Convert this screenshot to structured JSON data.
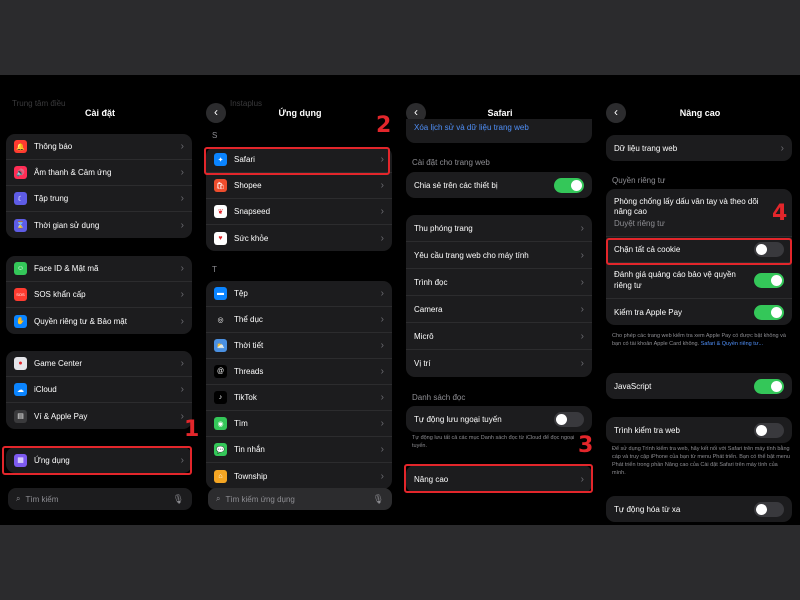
{
  "panel1": {
    "faded_top": "Trung tâm điều",
    "title": "Cài đặt",
    "group1": [
      {
        "label": "Thông báo",
        "color": "#ff3b30",
        "icon": "bell-icon",
        "glyph": "🔔"
      },
      {
        "label": "Âm thanh & Cảm ứng",
        "color": "#ff2d55",
        "icon": "speaker-icon",
        "glyph": "🔊"
      },
      {
        "label": "Tập trung",
        "color": "#5e5ce6",
        "icon": "moon-icon",
        "glyph": "☾"
      },
      {
        "label": "Thời gian sử dụng",
        "color": "#5e5ce6",
        "icon": "hourglass-icon",
        "glyph": "⌛"
      }
    ],
    "group2": [
      {
        "label": "Face ID & Mật mã",
        "color": "#34c759",
        "icon": "faceid-icon",
        "glyph": "☺"
      },
      {
        "label": "SOS khẩn cấp",
        "color": "#ff3b30",
        "icon": "sos-icon",
        "glyph": "SOS"
      },
      {
        "label": "Quyền riêng tư & Bảo mật",
        "color": "#0a84ff",
        "icon": "hand-icon",
        "glyph": "✋"
      }
    ],
    "group3": [
      {
        "label": "Game Center",
        "color": "#e5e5ea",
        "icon": "game-center-icon",
        "glyph": "●"
      },
      {
        "label": "iCloud",
        "color": "#0a84ff",
        "icon": "cloud-icon",
        "glyph": "☁"
      },
      {
        "label": "Ví & Apple Pay",
        "color": "#3a3a3c",
        "icon": "wallet-icon",
        "glyph": "▤"
      }
    ],
    "apps_row": {
      "label": "Ứng dụng",
      "color": "#7d5af0",
      "icon": "apps-grid-icon",
      "glyph": "▦"
    },
    "search_placeholder": "Tìm kiếm",
    "step": "1"
  },
  "panel2": {
    "faded_top": "Instaplus",
    "title": "Ứng dụng",
    "section_s": "S",
    "group_s": [
      {
        "label": "Safari",
        "color": "#0a84ff",
        "icon": "safari-icon",
        "glyph": "✦"
      },
      {
        "label": "Shopee",
        "color": "#ee4d2d",
        "icon": "shopee-icon",
        "glyph": "🛍"
      },
      {
        "label": "Snapseed",
        "color": "#ffffff",
        "icon": "snapseed-icon",
        "glyph": "❦"
      },
      {
        "label": "Sức khỏe",
        "color": "#ffffff",
        "icon": "health-icon",
        "glyph": "♥"
      }
    ],
    "section_t": "T",
    "group_t": [
      {
        "label": "Tệp",
        "color": "#0a84ff",
        "icon": "files-icon",
        "glyph": "▬"
      },
      {
        "label": "Thể dục",
        "color": "#1c1c1e",
        "icon": "fitness-icon",
        "glyph": "◎"
      },
      {
        "label": "Thời tiết",
        "color": "#4a90e2",
        "icon": "weather-icon",
        "glyph": "⛅"
      },
      {
        "label": "Threads",
        "color": "#000000",
        "icon": "threads-icon",
        "glyph": "@"
      },
      {
        "label": "TikTok",
        "color": "#000000",
        "icon": "tiktok-icon",
        "glyph": "♪"
      },
      {
        "label": "Tìm",
        "color": "#34c759",
        "icon": "find-my-icon",
        "glyph": "◉"
      },
      {
        "label": "Tin nhắn",
        "color": "#34c759",
        "icon": "messages-icon",
        "glyph": "💬"
      },
      {
        "label": "Township",
        "color": "#f5a623",
        "icon": "township-icon",
        "glyph": "⌂"
      }
    ],
    "search_placeholder": "Tìm kiếm ứng dụng",
    "step": "2"
  },
  "panel3": {
    "title": "Safari",
    "clear_history_link": "Xóa lịch sử và dữ liệu trang web",
    "section_web": "Cài đặt cho trang web",
    "share_devices": "Chia sẻ trên các thiết bị",
    "web_rows": [
      "Thu phóng trang",
      "Yêu cầu trang web cho máy tính",
      "Trình đọc",
      "Camera",
      "Micrô",
      "Vị trí"
    ],
    "section_reading": "Danh sách đọc",
    "auto_offline": "Tự động lưu ngoại tuyến",
    "reading_note": "Tự động lưu tất cả các mục Danh sách đọc từ iCloud để đọc ngoại tuyến.",
    "advanced": "Nâng cao",
    "step": "3"
  },
  "panel4": {
    "title": "Nâng cao",
    "website_data": "Dữ liệu trang web",
    "section_privacy": "Quyền riêng tư",
    "fingerprint": "Phòng chống lấy dấu vân tay và theo dõi nâng cao",
    "fingerprint_value": "Duyệt riêng tư",
    "block_cookies": "Chặn tất cả cookie",
    "privacy_ads": "Đánh giá quảng cáo bảo vệ quyền riêng tư",
    "check_apple_pay": "Kiểm tra Apple Pay",
    "apple_pay_note": "Cho phép các trang web kiểm tra xem Apple Pay có được bật không và bạn có tài khoản Apple Card không.",
    "apple_pay_link": "Safari & Quyền riêng tư...",
    "javascript": "JavaScript",
    "web_inspector": "Trình kiểm tra web",
    "inspector_note": "Để sử dụng Trình kiểm tra web, hãy kết nối với Safari trên máy tính bằng cáp và truy cập iPhone của bạn từ menu Phát triển. Bạn có thể bật menu Phát triển trong phần Nâng cao của Cài đặt Safari trên máy tính của mình.",
    "remote_automation": "Tự động hóa từ xa",
    "step": "4"
  }
}
